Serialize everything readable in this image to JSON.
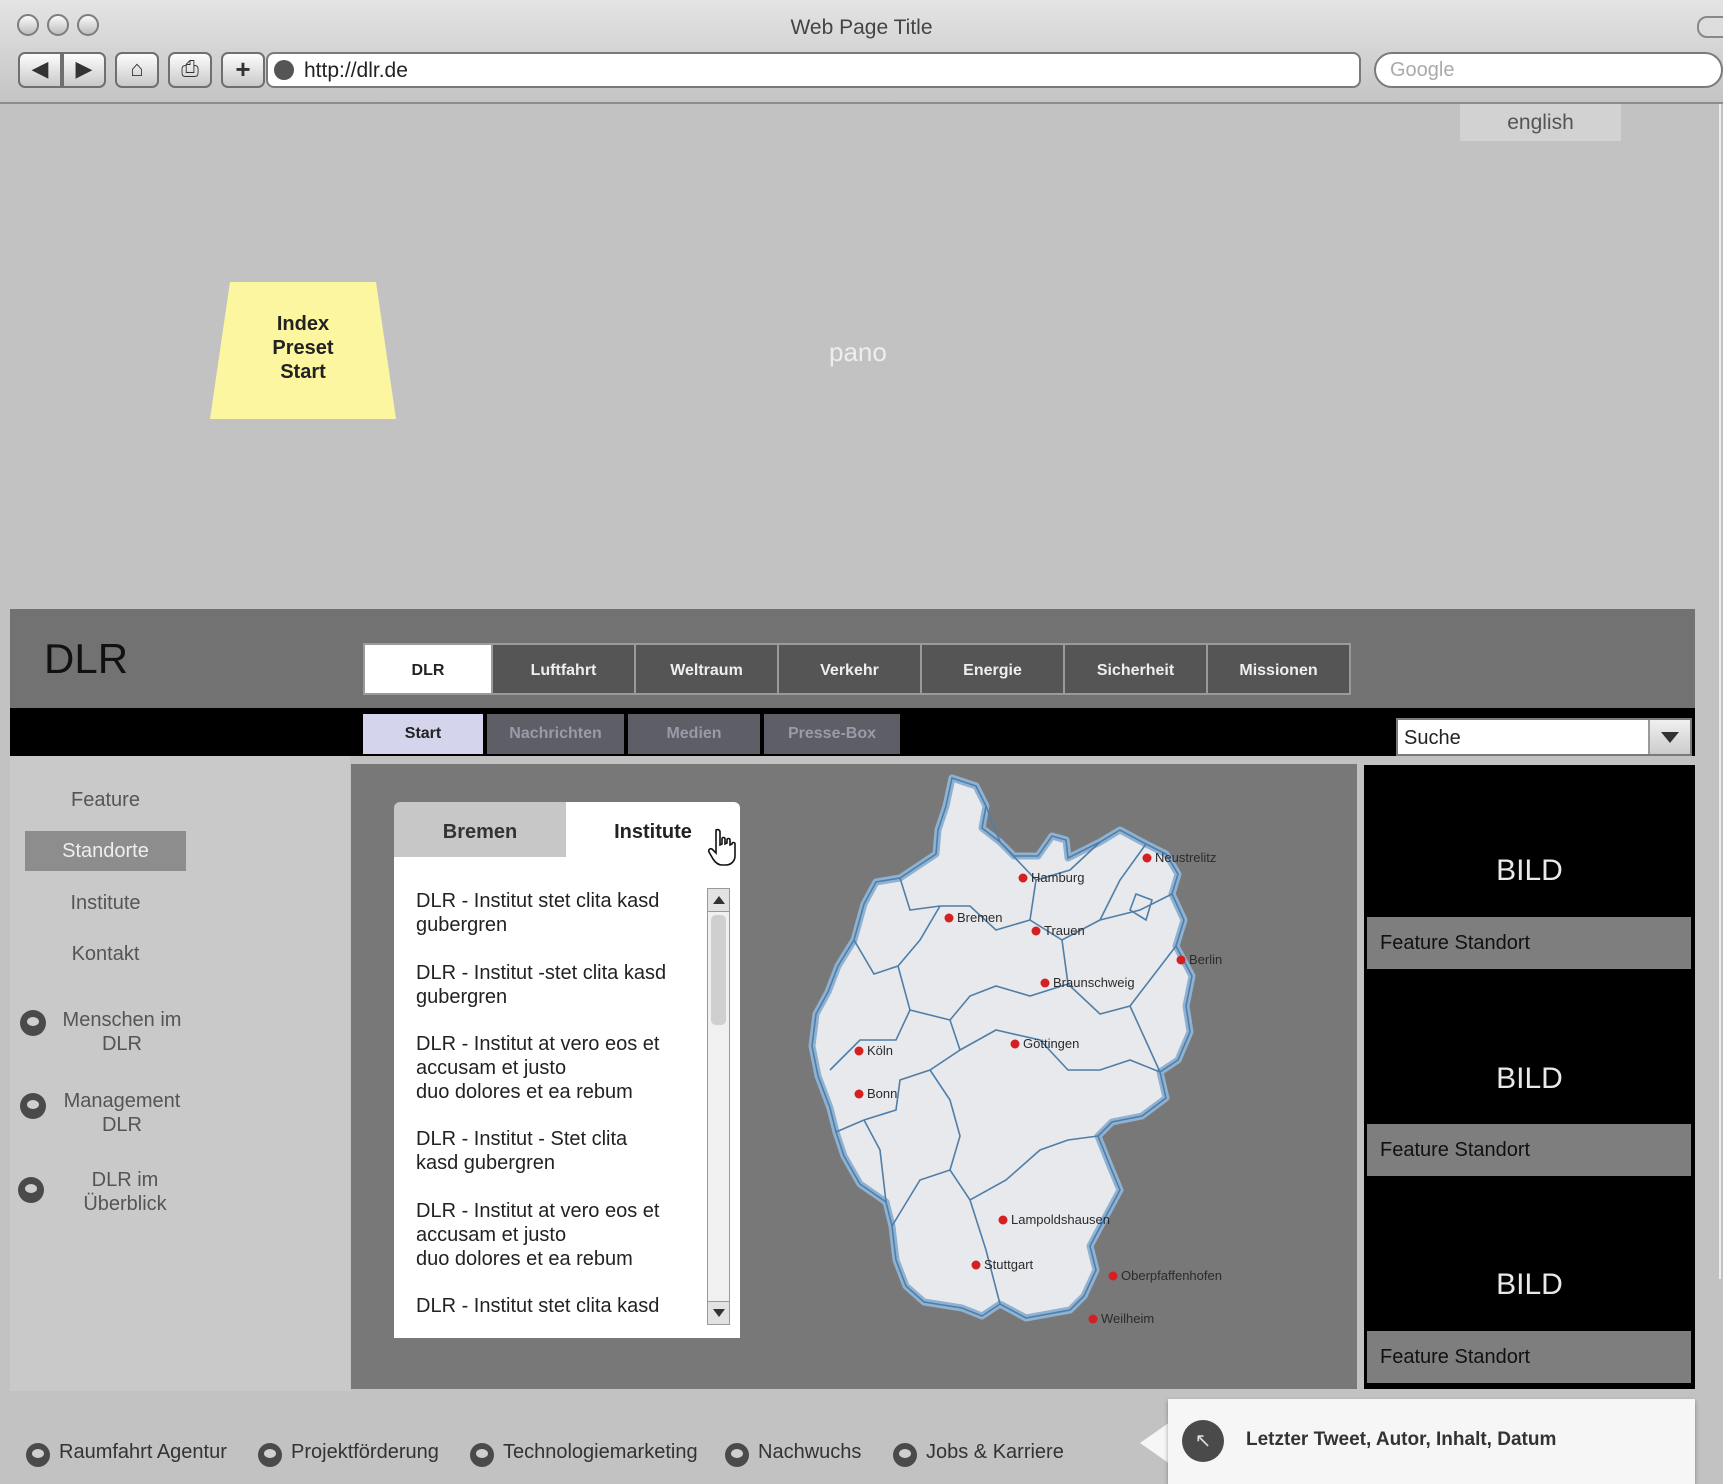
{
  "browser": {
    "title": "Web Page Title",
    "url": "http://dlr.de",
    "search_placeholder": "Google",
    "back_label": "◀",
    "forward_label": "▶",
    "home_label": "⌂",
    "print_label": "⎙",
    "add_label": "+"
  },
  "page": {
    "lang_label": "english",
    "pano_label": "pano",
    "sticky_note": [
      "Index",
      "Preset",
      "Start"
    ]
  },
  "header": {
    "logo": "DLR",
    "main_tabs": [
      "DLR",
      "Luftfahrt",
      "Weltraum",
      "Verkehr",
      "Energie",
      "Sicherheit",
      "Missionen"
    ],
    "active_main_tab": "DLR",
    "sub_tabs": [
      "Start",
      "Nachrichten",
      "Medien",
      "Presse-Box"
    ],
    "active_sub_tab": "Start",
    "search_value": "Suche"
  },
  "sidebar": {
    "items": [
      "Feature",
      "Standorte",
      "Institute",
      "Kontakt"
    ],
    "active": "Standorte",
    "links": [
      {
        "line1": "Menschen im",
        "line2": "DLR"
      },
      {
        "line1": "Management",
        "line2": "DLR"
      },
      {
        "line1": "DLR im",
        "line2": "Überblick"
      }
    ]
  },
  "center": {
    "tabs": [
      "Bremen",
      "Institute"
    ],
    "active_tab": "Institute",
    "list": [
      [
        "DLR - Institut stet clita kasd",
        "gubergren"
      ],
      [
        "DLR - Institut -stet clita kasd",
        "gubergren"
      ],
      [
        "DLR - Institut  at vero eos et",
        "accusam et justo",
        "duo dolores et ea rebum"
      ],
      [
        "DLR - Institut  - Stet clita",
        "kasd gubergren"
      ],
      [
        "DLR - Institut  at vero eos et",
        "accusam et justo",
        "duo dolores et ea rebum"
      ],
      [
        "DLR - Institut  stet clita kasd"
      ]
    ]
  },
  "map": {
    "cities": [
      "Neustrelitz",
      "Hamburg",
      "Bremen",
      "Trauen",
      "Berlin",
      "Braunschweig",
      "Köln",
      "Göttingen",
      "Bonn",
      "Lampoldshausen",
      "Stuttgart",
      "Oberpfaffenhofen",
      "Weilheim"
    ],
    "city_color": "#d42020",
    "land_color": "#e8e9ec",
    "border_color": "#4f7ea8"
  },
  "right": {
    "bild_label": "BILD",
    "feature_label": "Feature Standort"
  },
  "footer": {
    "links": [
      "Raumfahrt Agentur",
      "Projektförderung",
      "Technologiemarketing",
      "Nachwuchs",
      "Jobs & Karriere"
    ],
    "tweet": "Letzter Tweet, Autor, Inhalt, Datum"
  }
}
